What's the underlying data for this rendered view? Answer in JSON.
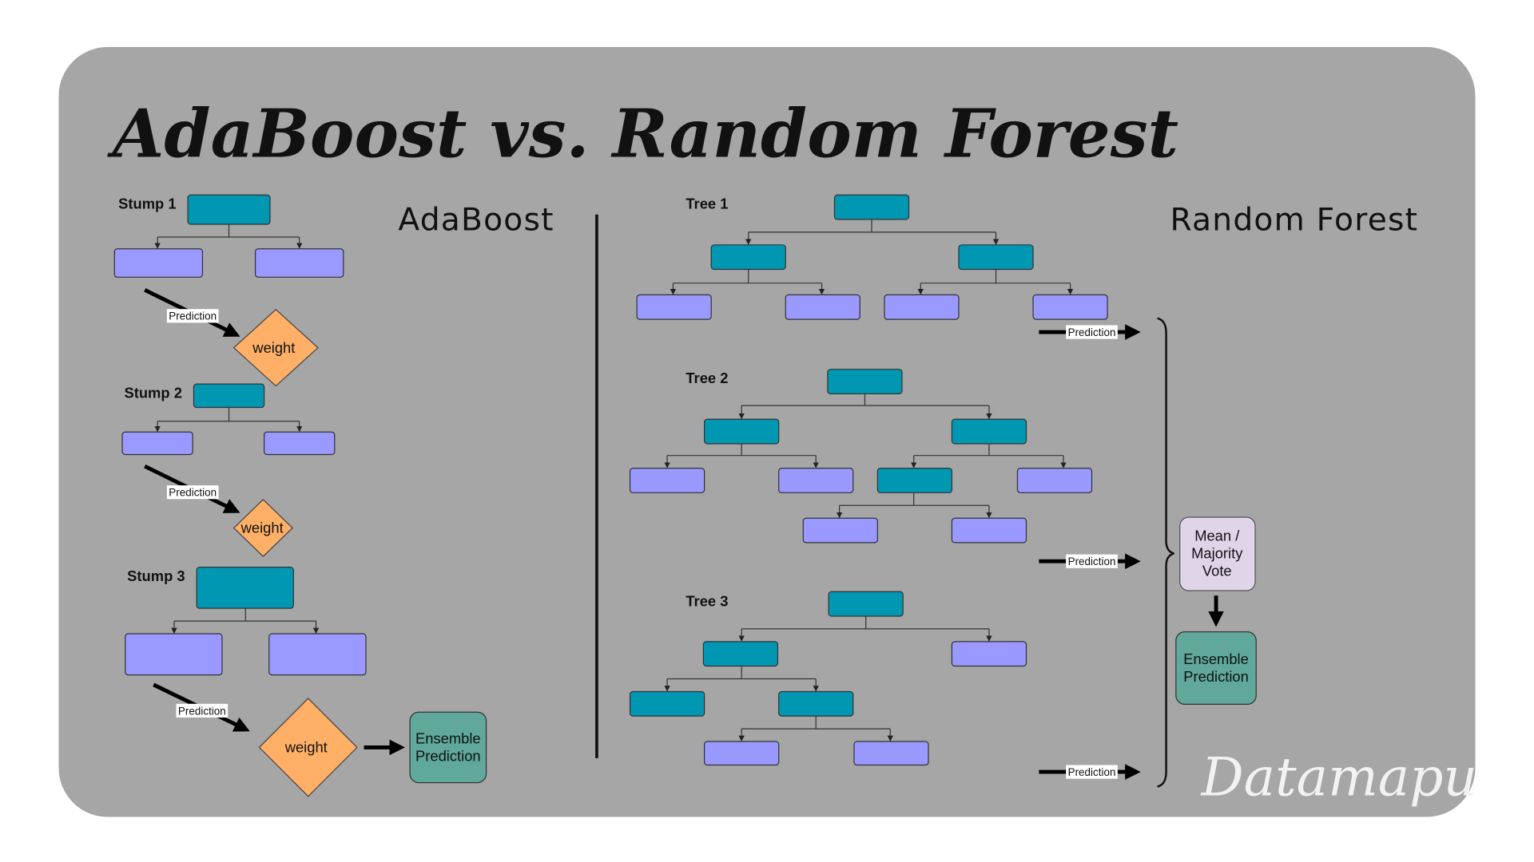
{
  "title": "AdaBoost vs. Random Forest",
  "adaboost": {
    "heading": "AdaBoost",
    "stumps": [
      "Stump 1",
      "Stump 2",
      "Stump 3"
    ],
    "prediction_label": "Prediction",
    "weight_label": "weight",
    "ensemble_label": [
      "Ensemble",
      "Prediction"
    ]
  },
  "random_forest": {
    "heading": "Random Forest",
    "trees": [
      "Tree 1",
      "Tree 2",
      "Tree 3"
    ],
    "prediction_label": "Prediction",
    "vote_label": [
      "Mean /",
      "Majority",
      "Vote"
    ],
    "ensemble_label": [
      "Ensemble",
      "Prediction"
    ]
  },
  "watermark": "Datamapu",
  "colors": {
    "background_panel": "#a6a6a6",
    "decision_node": "#0097b2",
    "leaf_node": "#9999ff",
    "weight_diamond": "#ffb066",
    "ensemble_box": "#5fa89a",
    "vote_box": "#e0d5e8"
  }
}
